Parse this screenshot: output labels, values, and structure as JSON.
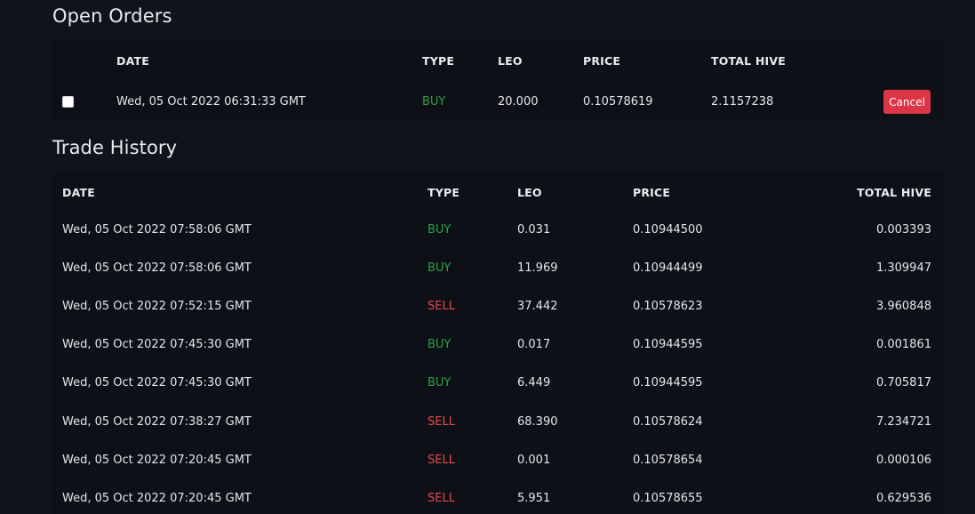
{
  "open_orders": {
    "title": "Open Orders",
    "headers": {
      "date": "DATE",
      "type": "TYPE",
      "leo": "LEO",
      "price": "PRICE",
      "total_hive": "TOTAL HIVE"
    },
    "rows": [
      {
        "date": "Wed, 05 Oct 2022 06:31:33 GMT",
        "type": "BUY",
        "leo": "20.000",
        "price": "0.10578619",
        "total_hive": "2.1157238",
        "cancel_label": "Cancel"
      }
    ]
  },
  "trade_history": {
    "title": "Trade History",
    "headers": {
      "date": "DATE",
      "type": "TYPE",
      "leo": "LEO",
      "price": "PRICE",
      "total_hive": "TOTAL HIVE"
    },
    "rows": [
      {
        "date": "Wed, 05 Oct 2022 07:58:06 GMT",
        "type": "BUY",
        "leo": "0.031",
        "price": "0.10944500",
        "total_hive": "0.003393"
      },
      {
        "date": "Wed, 05 Oct 2022 07:58:06 GMT",
        "type": "BUY",
        "leo": "11.969",
        "price": "0.10944499",
        "total_hive": "1.309947"
      },
      {
        "date": "Wed, 05 Oct 2022 07:52:15 GMT",
        "type": "SELL",
        "leo": "37.442",
        "price": "0.10578623",
        "total_hive": "3.960848"
      },
      {
        "date": "Wed, 05 Oct 2022 07:45:30 GMT",
        "type": "BUY",
        "leo": "0.017",
        "price": "0.10944595",
        "total_hive": "0.001861"
      },
      {
        "date": "Wed, 05 Oct 2022 07:45:30 GMT",
        "type": "BUY",
        "leo": "6.449",
        "price": "0.10944595",
        "total_hive": "0.705817"
      },
      {
        "date": "Wed, 05 Oct 2022 07:38:27 GMT",
        "type": "SELL",
        "leo": "68.390",
        "price": "0.10578624",
        "total_hive": "7.234721"
      },
      {
        "date": "Wed, 05 Oct 2022 07:20:45 GMT",
        "type": "SELL",
        "leo": "0.001",
        "price": "0.10578654",
        "total_hive": "0.000106"
      },
      {
        "date": "Wed, 05 Oct 2022 07:20:45 GMT",
        "type": "SELL",
        "leo": "5.951",
        "price": "0.10578655",
        "total_hive": "0.629536"
      }
    ]
  },
  "colors": {
    "background": "#0f131a",
    "buy": "#2ea043",
    "sell": "#e5484d",
    "cancel_button": "#dc3545"
  }
}
